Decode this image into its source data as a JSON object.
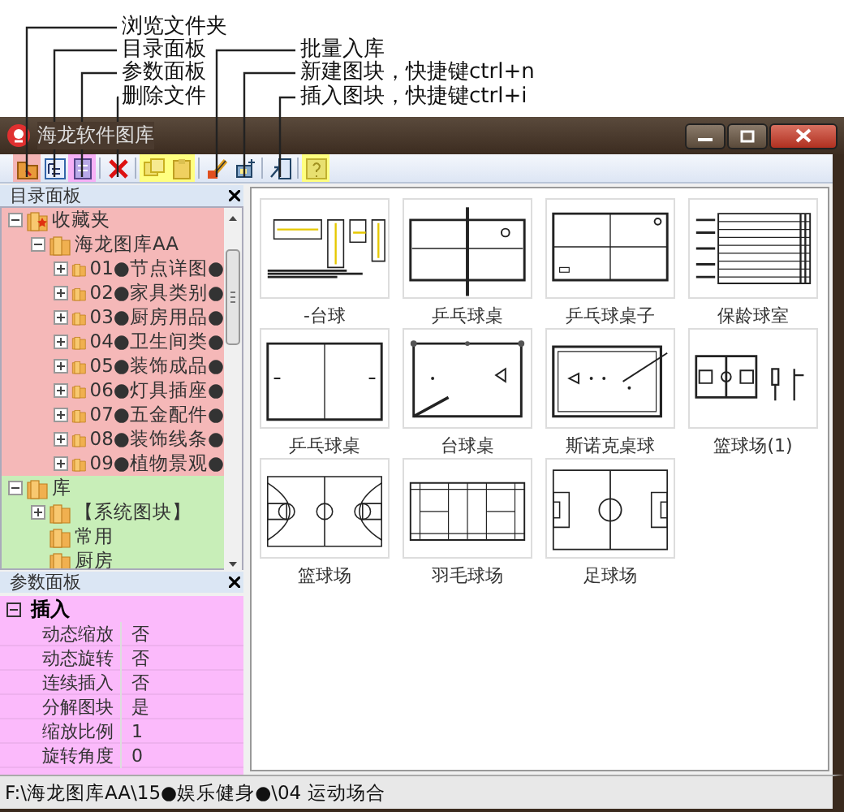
{
  "window": {
    "title": "海龙软件图库"
  },
  "toolbar": [
    {
      "kind": "button",
      "color": "#f4b4b4",
      "callout": "浏览文件夹"
    },
    {
      "kind": "button",
      "callout": "目录面板"
    },
    {
      "kind": "button",
      "color": "#f6b0f6",
      "callout": "参数面板"
    },
    {
      "kind": "separator"
    },
    {
      "kind": "button",
      "callout": "删除文件"
    },
    {
      "kind": "separator"
    },
    {
      "kind": "button",
      "color": "#ffff80"
    },
    {
      "kind": "button",
      "color": "#ffff80"
    },
    {
      "kind": "separator"
    },
    {
      "kind": "button",
      "callout": "批量入库"
    },
    {
      "kind": "button",
      "callout": "新建图块，快捷键ctrl+n"
    },
    {
      "kind": "separator"
    },
    {
      "kind": "button",
      "callout": "插入图块，快捷键ctrl+i"
    },
    {
      "kind": "separator"
    },
    {
      "kind": "button",
      "color": "#ffff80"
    }
  ],
  "directory_panel": {
    "title": "目录面板",
    "nodes": [
      {
        "label": "收藏夹",
        "expanded": true,
        "color": "#f5b8b8",
        "children": [
          {
            "label": "海龙图库AA",
            "expanded": true,
            "children": [
              {
                "label": "01●节点详图●",
                "expanded": false
              },
              {
                "label": "02●家具类别●",
                "expanded": false
              },
              {
                "label": "03●厨房用品●",
                "expanded": false
              },
              {
                "label": "04●卫生间类●",
                "expanded": false
              },
              {
                "label": "05●装饰成品●",
                "expanded": false
              },
              {
                "label": "06●灯具插座●",
                "expanded": false
              },
              {
                "label": "07●五金配件●",
                "expanded": false
              },
              {
                "label": "08●装饰线条●",
                "expanded": false
              },
              {
                "label": "09●植物景观●",
                "expanded": false
              }
            ]
          }
        ]
      },
      {
        "label": "库",
        "expanded": true,
        "color": "#c8eeb8",
        "children": [
          {
            "label": "【系统图块】",
            "expanded": false
          },
          {
            "label": "常用"
          },
          {
            "label": "厨房"
          }
        ]
      }
    ]
  },
  "params_panel": {
    "title": "参数面板",
    "color": "#fbbafb",
    "group": {
      "label": "插入",
      "expanded": true
    },
    "rows": [
      {
        "name": "动态缩放",
        "value": "否"
      },
      {
        "name": "动态旋转",
        "value": "否"
      },
      {
        "name": "连续插入",
        "value": "否"
      },
      {
        "name": "分解图块",
        "value": "是"
      },
      {
        "name": "缩放比例",
        "value": "1"
      },
      {
        "name": "旋转角度",
        "value": "0"
      }
    ]
  },
  "gallery": [
    {
      "label": "-台球",
      "kind": "layout"
    },
    {
      "label": "乒乓球桌",
      "kind": "table-net"
    },
    {
      "label": "乒乓球桌子",
      "kind": "table-plain"
    },
    {
      "label": "保龄球室",
      "kind": "bowling"
    },
    {
      "label": "乒乓球桌",
      "kind": "table-half"
    },
    {
      "label": "台球桌",
      "kind": "billiard"
    },
    {
      "label": "斯诺克桌球",
      "kind": "snooker"
    },
    {
      "label": "篮球场(1)",
      "kind": "small-court"
    },
    {
      "label": "篮球场",
      "kind": "basketball"
    },
    {
      "label": "羽毛球场",
      "kind": "badminton"
    },
    {
      "label": "足球场",
      "kind": "football"
    }
  ],
  "status_bar": "F:\\海龙图库AA\\15●娱乐健身●\\04 运动场合"
}
